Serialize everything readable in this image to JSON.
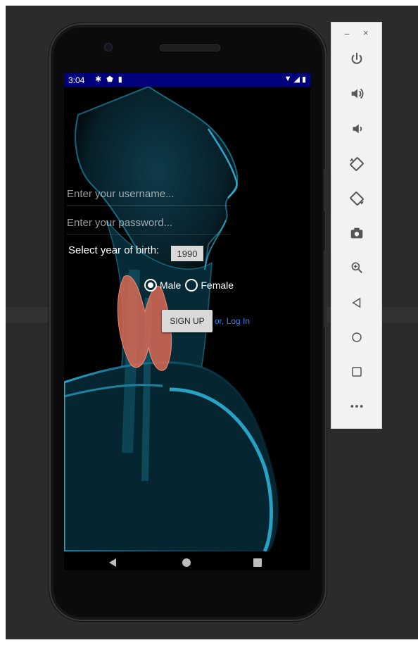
{
  "status_bar": {
    "time": "3:04"
  },
  "form": {
    "username_placeholder": "Enter your username...",
    "password_placeholder": "Enter your password...",
    "dob_label": "Select year of birth:",
    "year_value": "1990",
    "gender_options": [
      "Male",
      "Female"
    ],
    "gender_selected": "Male",
    "signup_label": "SIGN UP",
    "login_link": "or, Log In"
  },
  "toolbar": {
    "minimize": "−",
    "close": "×",
    "buttons": [
      {
        "name": "power-icon",
        "glyph": "⏻"
      },
      {
        "name": "volume-up-icon",
        "glyph": "🔊"
      },
      {
        "name": "volume-down-icon",
        "glyph": "🔈"
      },
      {
        "name": "rotate-left-icon",
        "glyph": "⬦"
      },
      {
        "name": "rotate-right-icon",
        "glyph": "⬦"
      },
      {
        "name": "screenshot-icon",
        "glyph": "📷"
      },
      {
        "name": "zoom-icon",
        "glyph": "⊕"
      },
      {
        "name": "back-icon",
        "glyph": "◁"
      },
      {
        "name": "home-icon",
        "glyph": "○"
      },
      {
        "name": "overview-icon",
        "glyph": "□"
      },
      {
        "name": "more-icon",
        "glyph": "•••"
      }
    ]
  },
  "colors": {
    "status_bar": "#00007a",
    "link": "#2f7ff0",
    "skin_glow": "#1fa3c9",
    "thyroid": "#d96a55"
  }
}
